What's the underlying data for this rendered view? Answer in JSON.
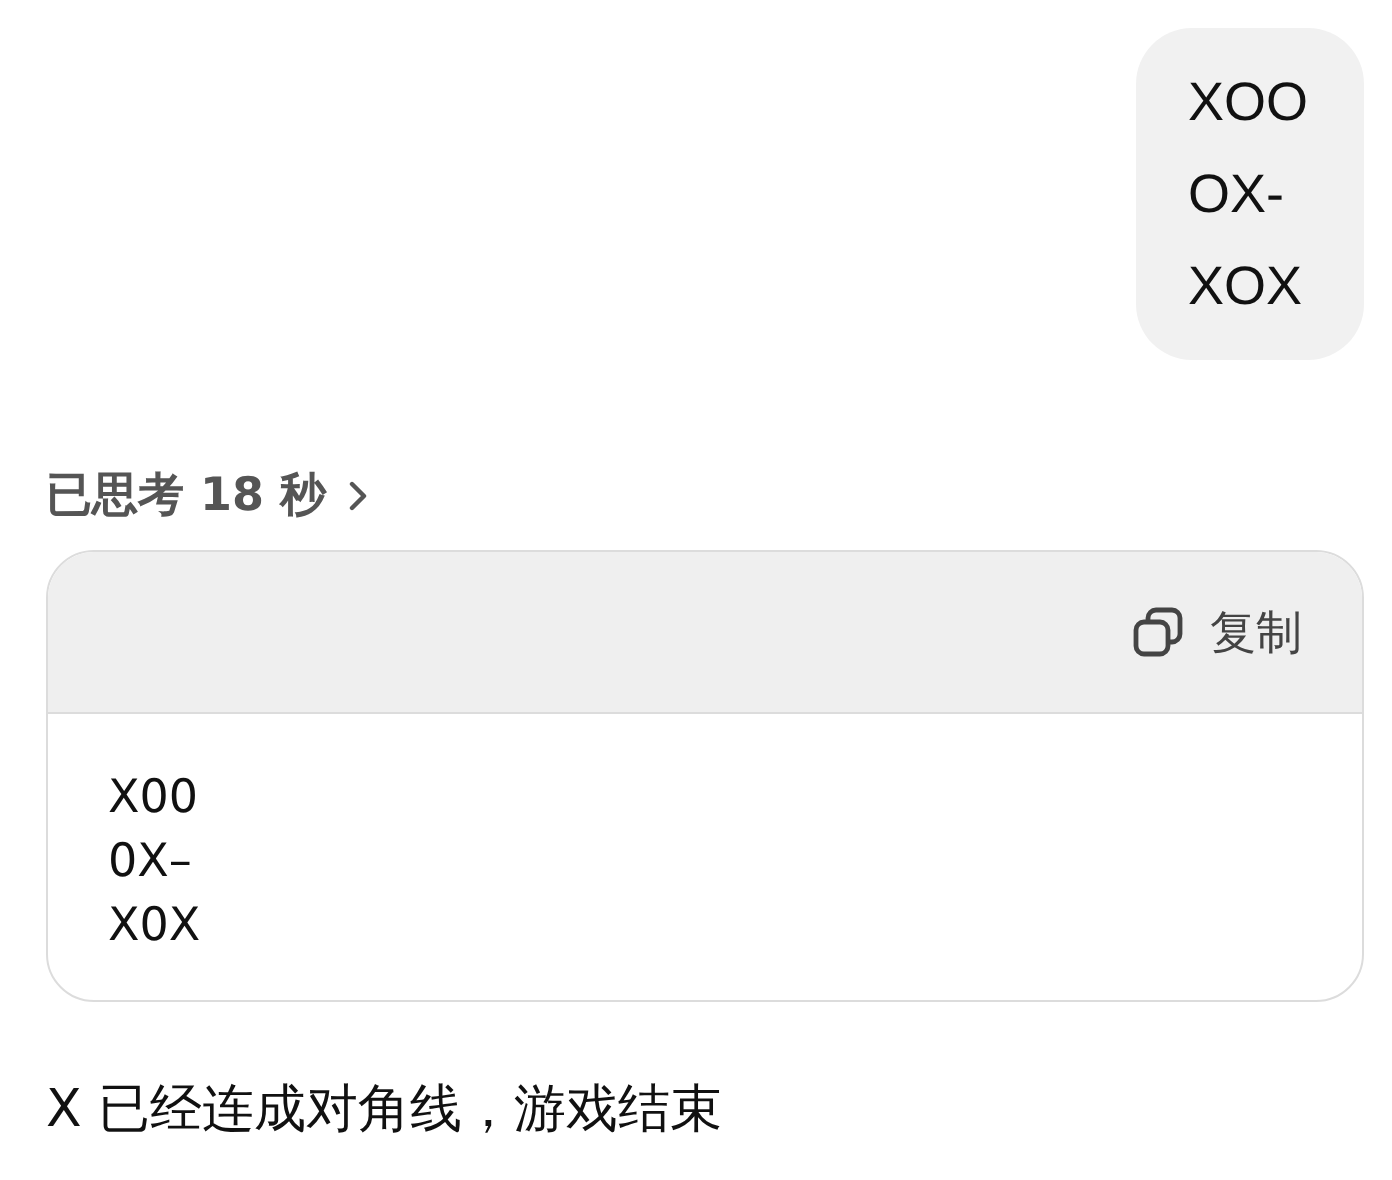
{
  "user_message": {
    "lines": [
      "XOO",
      "OX-",
      "XOX"
    ]
  },
  "thinking": {
    "label": "已思考 18 秒",
    "expanded": false
  },
  "code_block": {
    "copy_label": "复制",
    "code": "X00\n0X–\nX0X"
  },
  "reply": "X 已经连成对角线，游戏结束"
}
